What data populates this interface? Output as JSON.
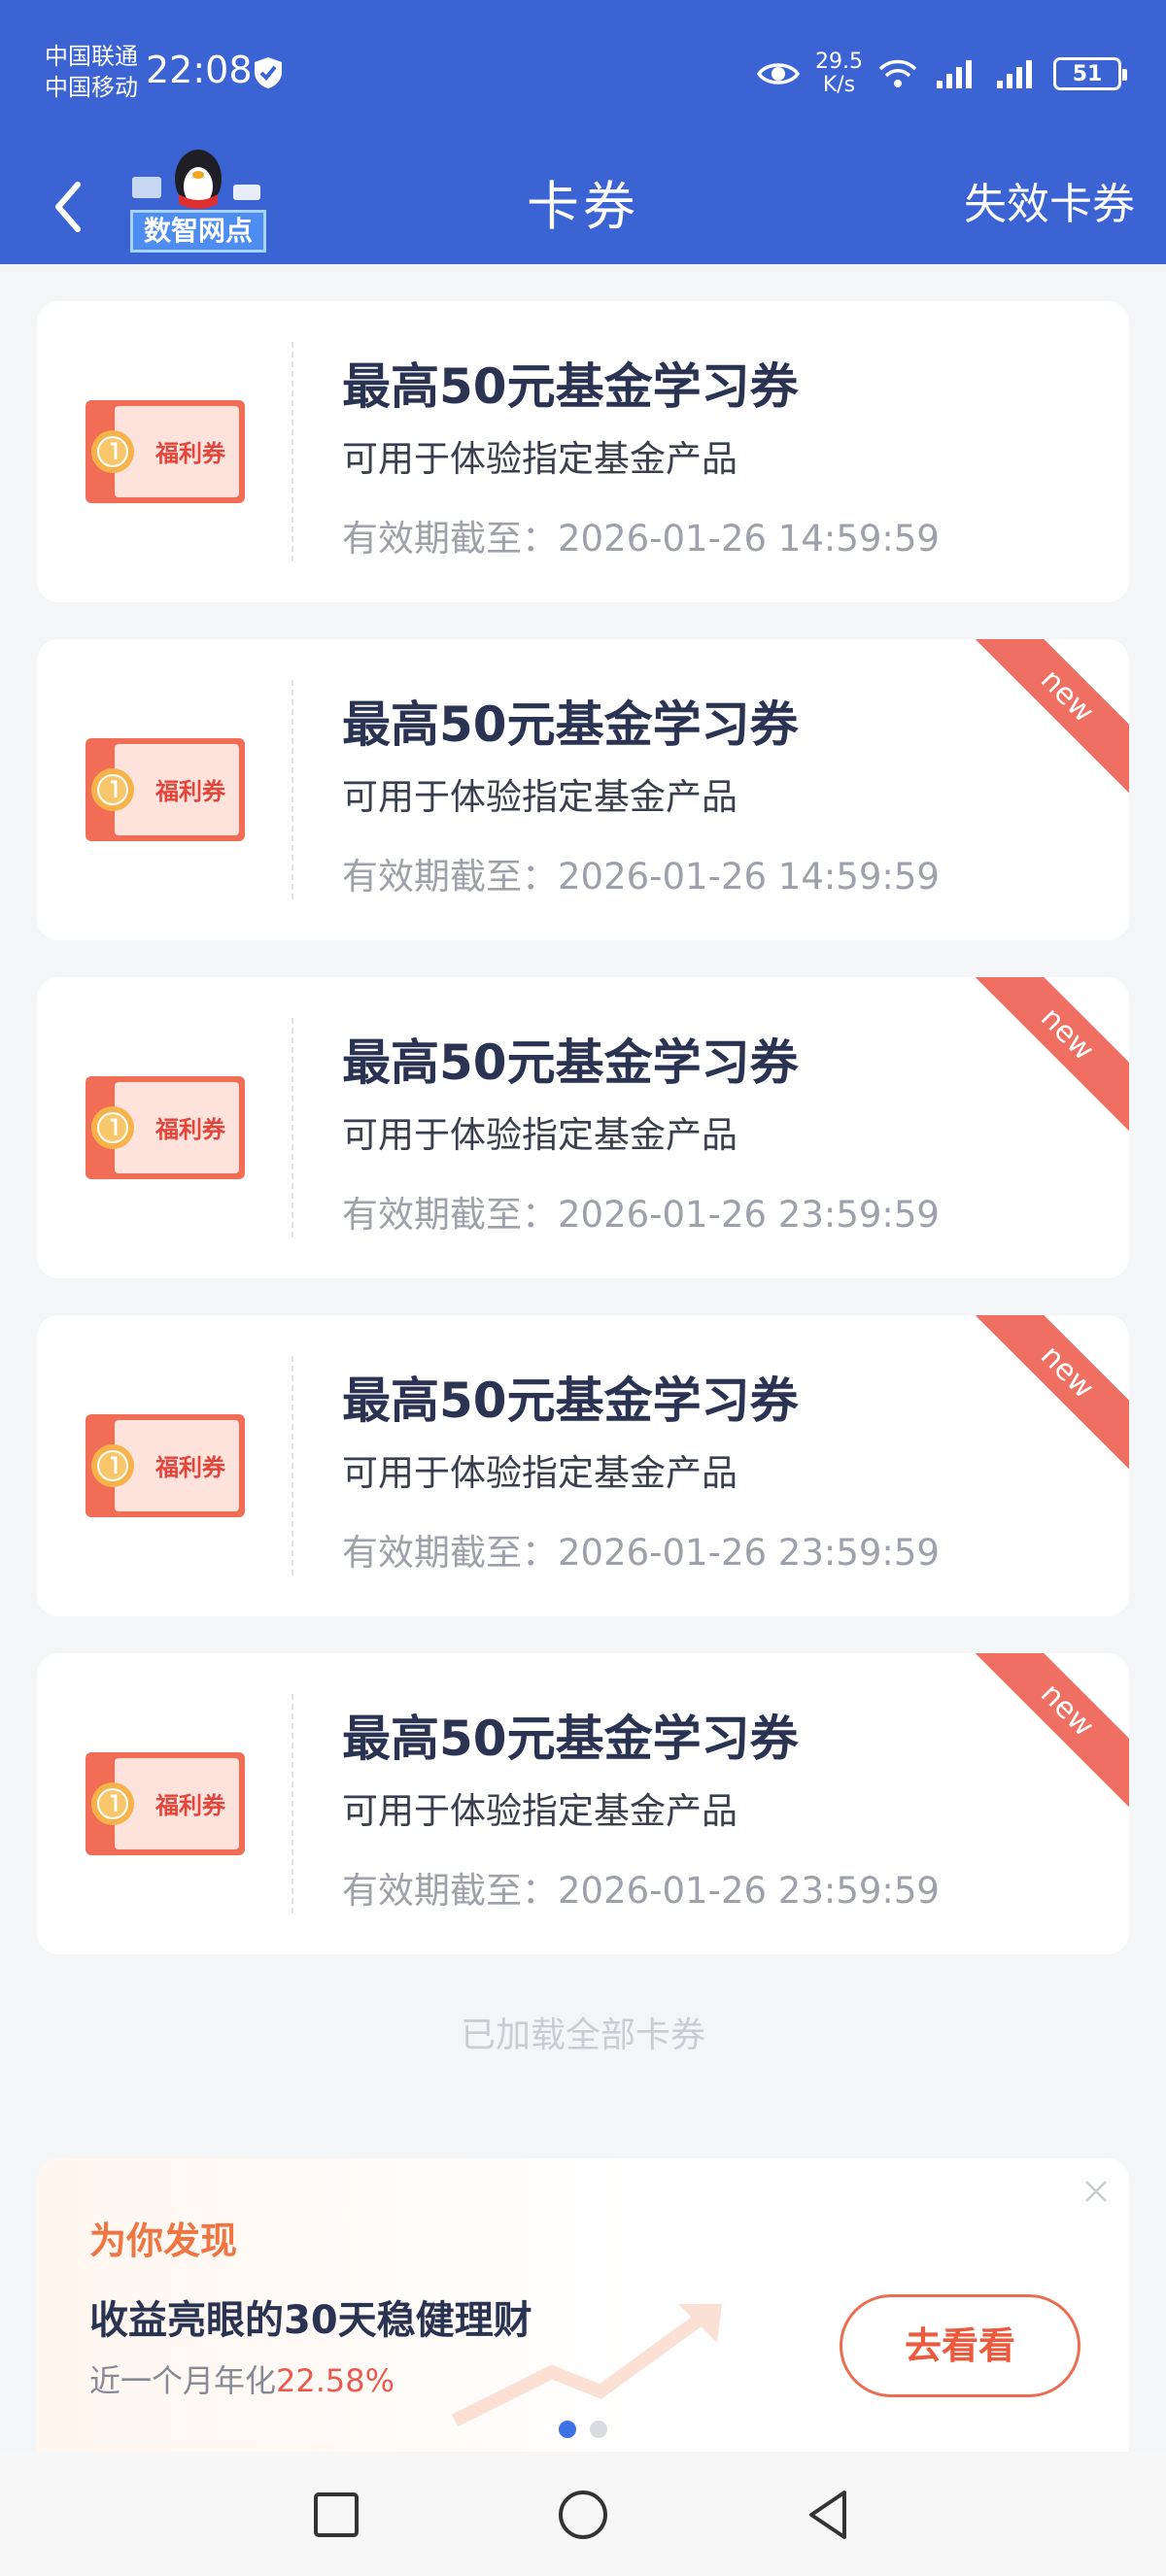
{
  "status_bar": {
    "carrier_1": "中国联通",
    "carrier_2": "中国移动",
    "time": "22:08",
    "speed_value": "29.5",
    "speed_unit": "K/s",
    "battery": "51",
    "icons": [
      "shield-check-icon",
      "eye-icon",
      "wifi-icon",
      "signal-icon",
      "battery-icon"
    ]
  },
  "nav": {
    "title": "卡券",
    "logo_text": "数智网点",
    "right_link": "失效卡券"
  },
  "ticket_label": "福利券",
  "coupons": [
    {
      "title": "最高50元基金学习券",
      "desc": "可用于体验指定基金产品",
      "expiry": "有效期截至：2026-01-26 14:59:59",
      "badge": ""
    },
    {
      "title": "最高50元基金学习券",
      "desc": "可用于体验指定基金产品",
      "expiry": "有效期截至：2026-01-26 14:59:59",
      "badge": "new"
    },
    {
      "title": "最高50元基金学习券",
      "desc": "可用于体验指定基金产品",
      "expiry": "有效期截至：2026-01-26 23:59:59",
      "badge": "new"
    },
    {
      "title": "最高50元基金学习券",
      "desc": "可用于体验指定基金产品",
      "expiry": "有效期截至：2026-01-26 23:59:59",
      "badge": "new"
    },
    {
      "title": "最高50元基金学习券",
      "desc": "可用于体验指定基金产品",
      "expiry": "有效期截至：2026-01-26 23:59:59",
      "badge": "new"
    }
  ],
  "loaded_all": "已加载全部卡券",
  "promo": {
    "heading": "为你发现",
    "title": "收益亮眼的30天稳健理财",
    "rate_prefix": "近一个月年化",
    "rate_value": "22.58%",
    "button": "去看看",
    "carousel_active": 1,
    "carousel_count": 2
  },
  "colors": {
    "header": "#3c63d4",
    "ribbon": "#ef6f63",
    "accent_orange": "#ec5a3e",
    "page_bg": "#f4f5f7"
  }
}
